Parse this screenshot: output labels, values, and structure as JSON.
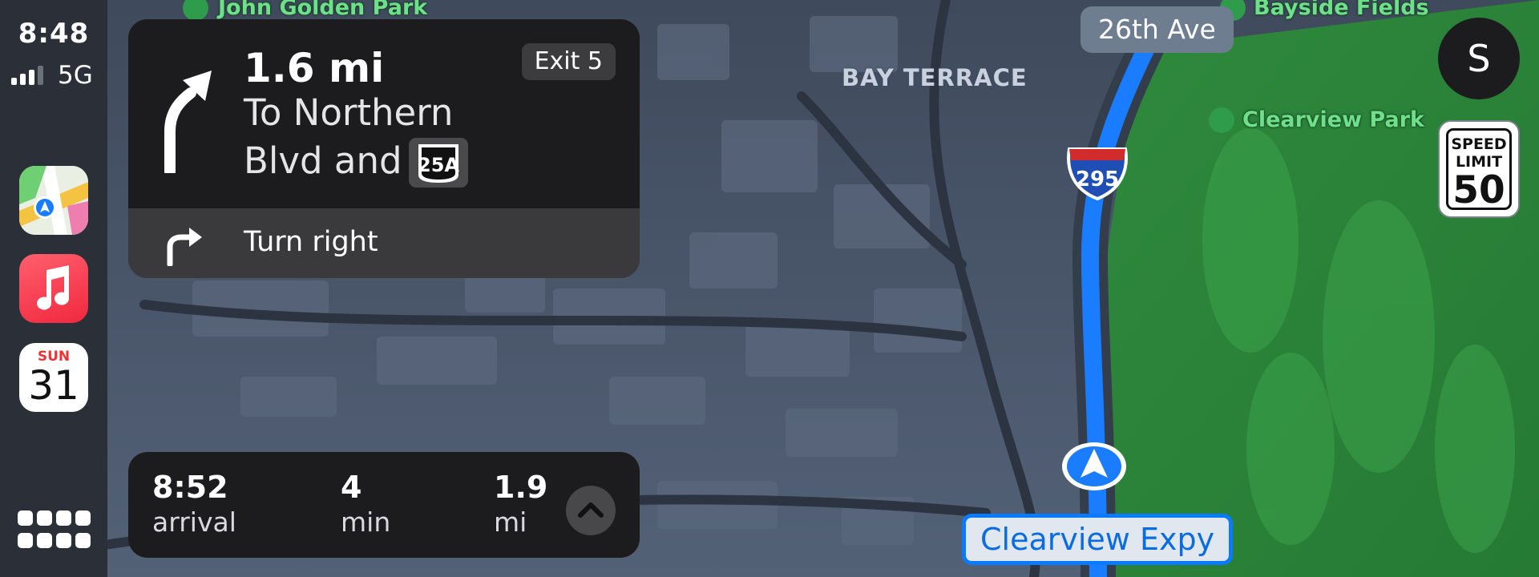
{
  "status": {
    "time": "8:48",
    "network": "5G",
    "signal_bars": 3,
    "signal_bars_total": 4
  },
  "dock": {
    "apps": [
      {
        "name": "Maps",
        "icon": "maps-icon"
      },
      {
        "name": "Music",
        "icon": "music-note-icon"
      },
      {
        "name": "Calendar",
        "icon": "calendar-icon",
        "weekday": "SUN",
        "day": "31"
      }
    ],
    "app_grid_icon": "app-grid-icon"
  },
  "maneuver": {
    "distance": "1.6 mi",
    "road_line1": "To Northern",
    "road_line2": "Blvd and",
    "route_shield": "25A",
    "exit": "Exit 5",
    "primary_icon": "bear-left-arrow-icon",
    "secondary_icon": "turn-right-arrow-icon",
    "secondary_text": "Turn right"
  },
  "trip": {
    "arrival_time": "8:52",
    "arrival_label": "arrival",
    "duration": "4",
    "duration_label": "min",
    "distance": "1.9",
    "distance_label": "mi",
    "expand_icon": "chevron-up-icon"
  },
  "map": {
    "labels": {
      "park1": "John Golden Park",
      "park2": "Bayside Fields",
      "park3": "Clearview Park",
      "neighborhood": "BAY TERRACE",
      "street": "26th Ave",
      "current_road": "Clearview Expy",
      "interstate": "295"
    },
    "speed_limit": {
      "line1": "SPEED",
      "line2": "LIMIT",
      "value": "50"
    },
    "user_initial": "S",
    "colors": {
      "route": "#1a7dff",
      "park": "#2f8a3d",
      "city": "#4e5b70",
      "dock": "#2b3038",
      "card": "#1c1c1e"
    }
  }
}
